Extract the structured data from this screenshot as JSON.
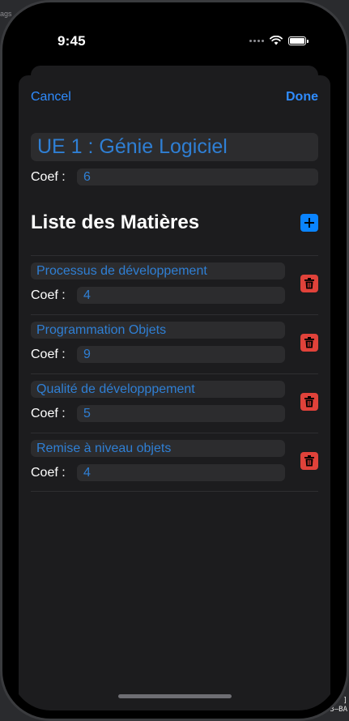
{
  "status_bar": {
    "time": "9:45"
  },
  "nav": {
    "cancel_label": "Cancel",
    "done_label": "Done"
  },
  "ue": {
    "title": "UE 1 : Génie Logiciel",
    "coef_label": "Coef :",
    "coef_value": "6"
  },
  "section": {
    "title": "Liste des Matières"
  },
  "matieres": [
    {
      "name": "Processus de développement",
      "coef_label": "Coef :",
      "coef": "4"
    },
    {
      "name": "Programmation Objets",
      "coef_label": "Coef :",
      "coef": "9"
    },
    {
      "name": "Qualité de développpement",
      "coef_label": "Coef :",
      "coef": "5"
    },
    {
      "name": "Remise à niveau objets",
      "coef_label": "Coef :",
      "coef": "4"
    }
  ],
  "background": {
    "tag_text": "ags",
    "corner_text_1": "]",
    "corner_text_2": "3–BA"
  },
  "colors": {
    "accent": "#2f8cff",
    "field_text": "#2f7fd4",
    "delete": "#e0423a",
    "add": "#0a84ff",
    "sheet": "#1c1c1e"
  },
  "icons": {
    "add": "plus-icon",
    "delete": "trash-icon",
    "wifi": "wifi-icon",
    "battery": "battery-icon",
    "signal": "signal-dots-icon"
  }
}
